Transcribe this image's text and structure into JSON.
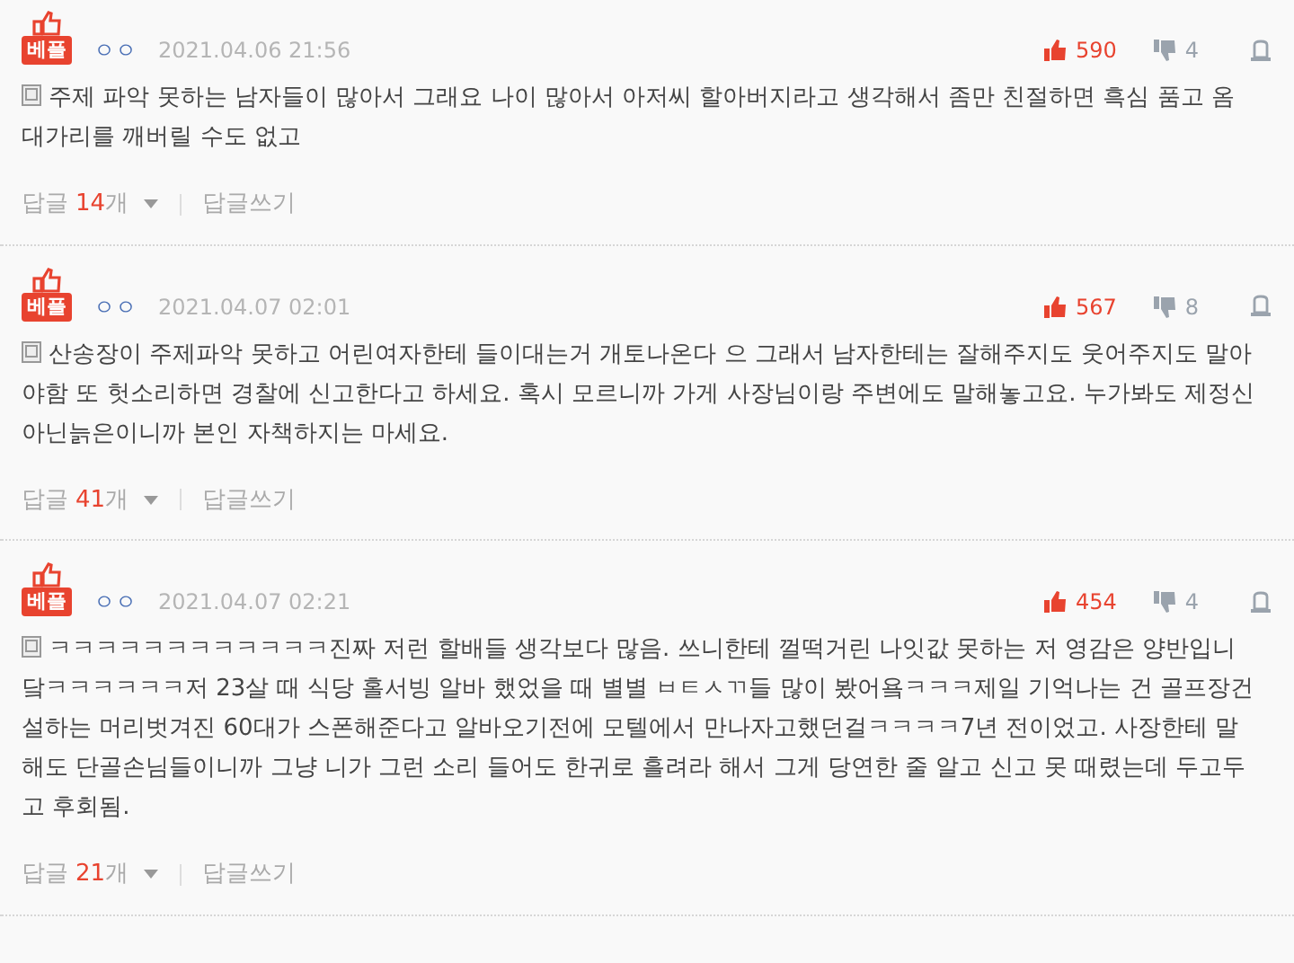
{
  "comments": [
    {
      "badge": "베플",
      "author": "ㅇㅇ",
      "date": "2021.04.06 21:56",
      "likes": "590",
      "dislikes": "4",
      "body": "주제 파악 못하는 남자들이 많아서 그래요 나이 많아서 아저씨 할아버지라고 생각해서 좀만 친절하면 흑심 품고 옴 대가리를 깨버릴 수도 없고",
      "reply_label": "답글",
      "reply_count": "14",
      "reply_unit": "개",
      "write_reply": "답글쓰기"
    },
    {
      "badge": "베플",
      "author": "ㅇㅇ",
      "date": "2021.04.07 02:01",
      "likes": "567",
      "dislikes": "8",
      "body": "산송장이 주제파악 못하고 어린여자한테 들이대는거 개토나온다 으 그래서 남자한테는 잘해주지도 웃어주지도 말아야함 또 헛소리하면 경찰에 신고한다고 하세요. 혹시 모르니까 가게 사장님이랑 주변에도 말해놓고요. 누가봐도 제정신 아닌늙은이니까 본인 자책하지는 마세요.",
      "reply_label": "답글",
      "reply_count": "41",
      "reply_unit": "개",
      "write_reply": "답글쓰기"
    },
    {
      "badge": "베플",
      "author": "ㅇㅇ",
      "date": "2021.04.07 02:21",
      "likes": "454",
      "dislikes": "4",
      "body": "ㅋㅋㅋㅋㅋㅋㅋㅋㅋㅋㅋㅋ진짜 저런 할배들 생각보다 많음. 쓰니한테 껄떡거린 나잇값 못하는 저 영감은 양반입니닼ㅋㅋㅋㅋㅋㅋ저 23살 때 식당 홀서빙 알바 했었을 때 별별 ㅂㅌㅅㄲ들 많이 봤어욬ㅋㅋㅋ제일 기억나는 건 골프장건설하는 머리벗겨진 60대가 스폰해준다고 알바오기전에 모텔에서 만나자고했던걸ㅋㅋㅋㅋ7년 전이었고. 사장한테 말해도 단골손님들이니까 그냥 니가 그런 소리 들어도 한귀로 흘려라 해서 그게 당연한 줄 알고 신고 못 때렸는데 두고두고 후회됨.",
      "reply_label": "답글",
      "reply_count": "21",
      "reply_unit": "개",
      "write_reply": "답글쓰기"
    }
  ]
}
